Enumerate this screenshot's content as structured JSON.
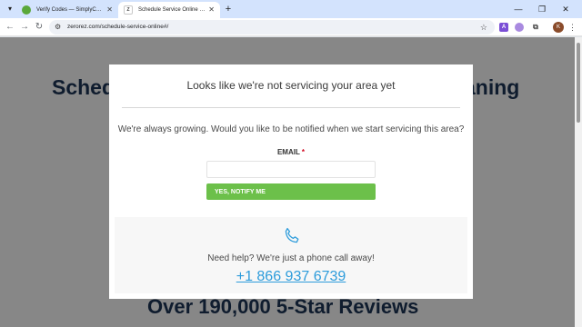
{
  "browser": {
    "tabs": [
      {
        "title": "Verify Codes — SimplyCodes",
        "active": false
      },
      {
        "title": "Schedule Service Online | Zerorez",
        "active": true
      }
    ],
    "new_tab_symbol": "+",
    "url": "zerorez.com/schedule-service-online#/",
    "profile_initial": "K",
    "extension_letter": "A"
  },
  "background": {
    "title_left": "Sched",
    "title_right": "aning",
    "reviews": "Over 190,000 5-Star Reviews"
  },
  "modal": {
    "title": "Looks like we're not servicing your area yet",
    "message": "We're always growing. Would you like to be notified when we start servicing this area?",
    "email_label": "EMAIL",
    "required_mark": "*",
    "email_value": "",
    "notify_button": "YES, NOTIFY ME",
    "help_text": "Need help? We're just a phone call away!",
    "phone": "+1 866 937 6739"
  },
  "colors": {
    "accent_green": "#6cc04a",
    "link_blue": "#2d9cdb",
    "heading_navy": "#1d3557",
    "tabstrip": "#d3e3fd"
  }
}
